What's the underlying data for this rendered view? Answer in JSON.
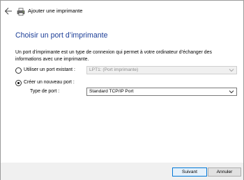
{
  "wizard": {
    "title": "Ajouter une imprimante",
    "heading": "Choisir un port d’imprimante",
    "description": "Un port d’imprimante est un type de connexion qui permet à votre ordinateur d’échanger des informations avec une imprimante."
  },
  "options": {
    "existing": {
      "label": "Utiliser un port existant :",
      "selected": false,
      "value": "LPT1: (Port imprimante)",
      "enabled": false
    },
    "new": {
      "label": "Créer un nouveau port :",
      "selected": true,
      "port_type_label": "Type de port :",
      "port_type_value": "Standard TCP/IP Port"
    }
  },
  "buttons": {
    "next": "Suivant",
    "cancel": "Annuler"
  },
  "icons": {
    "back": "back-arrow-icon",
    "printer": "printer-icon",
    "chevron": "chevron-down-icon"
  },
  "colors": {
    "heading": "#1c3e97",
    "default_button_border": "#0078d7"
  }
}
